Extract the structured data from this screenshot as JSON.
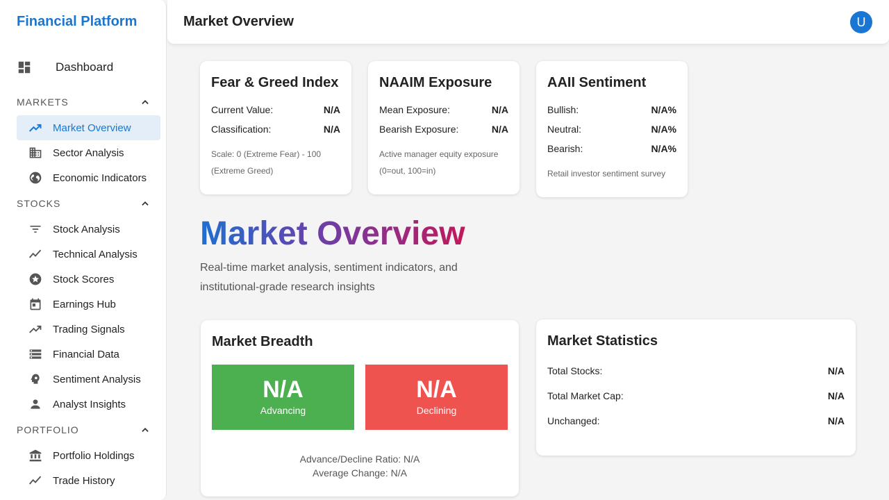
{
  "app": {
    "brand": "Financial Platform",
    "avatar_initial": "U"
  },
  "topbar": {
    "title": "Market Overview"
  },
  "sidebar": {
    "dashboard": "Dashboard",
    "sections": [
      {
        "label": "MARKETS",
        "items": [
          "Market Overview",
          "Sector Analysis",
          "Economic Indicators"
        ]
      },
      {
        "label": "STOCKS",
        "items": [
          "Stock Analysis",
          "Technical Analysis",
          "Stock Scores",
          "Earnings Hub",
          "Trading Signals",
          "Financial Data",
          "Sentiment Analysis",
          "Analyst Insights"
        ]
      },
      {
        "label": "PORTFOLIO",
        "items": [
          "Portfolio Holdings",
          "Trade History"
        ]
      }
    ],
    "active_item": "Market Overview"
  },
  "fear_greed": {
    "title": "Fear & Greed Index",
    "current_label": "Current Value:",
    "current_value": "N/A",
    "class_label": "Classification:",
    "class_value": "N/A",
    "note": "Scale: 0 (Extreme Fear) - 100 (Extreme Greed)"
  },
  "naaim": {
    "title": "NAAIM Exposure",
    "mean_label": "Mean Exposure:",
    "mean_value": "N/A",
    "bearish_label": "Bearish Exposure:",
    "bearish_value": "N/A",
    "note": "Active manager equity exposure (0=out, 100=in)"
  },
  "aaii": {
    "title": "AAII Sentiment",
    "bullish_label": "Bullish:",
    "bullish_value": "N/A%",
    "neutral_label": "Neutral:",
    "neutral_value": "N/A%",
    "bearish_label": "Bearish:",
    "bearish_value": "N/A%",
    "note": "Retail investor sentiment survey"
  },
  "hero": {
    "title": "Market Overview",
    "subtitle": "Real-time market analysis, sentiment indicators, and institutional-grade research insights"
  },
  "breadth": {
    "title": "Market Breadth",
    "advancing_value": "N/A",
    "advancing_label": "Advancing",
    "declining_value": "N/A",
    "declining_label": "Declining",
    "ratio_text": "Advance/Decline Ratio: N/A",
    "avg_text": "Average Change: N/A"
  },
  "stats": {
    "title": "Market Statistics",
    "rows": [
      {
        "label": "Total Stocks:",
        "value": "N/A"
      },
      {
        "label": "Total Market Cap:",
        "value": "N/A"
      },
      {
        "label": "Unchanged:",
        "value": "N/A"
      }
    ]
  },
  "colors": {
    "accent": "#1976d2",
    "advancing": "#4caf50",
    "declining": "#ef5350"
  }
}
